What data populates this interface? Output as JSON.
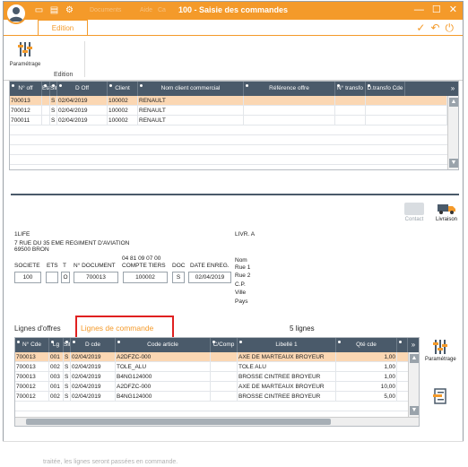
{
  "window": {
    "title": "100 - Saisie des commandes",
    "menu_ghost": [
      "Documents",
      "Aide",
      "Ca"
    ]
  },
  "ribbon": {
    "tab_label": "Edition",
    "param_label": "Paramétrage",
    "group_label": "Edition"
  },
  "offers_grid": {
    "headers": [
      "N° off",
      "Eta",
      "Sit",
      "D Off",
      "Client",
      "Nom client commercial",
      "Référence offre",
      "N° transfo",
      "D.transfo Cde"
    ],
    "rows": [
      {
        "n": "700013",
        "eta": "",
        "sit": "S",
        "date": "02/04/2019",
        "client": "100002",
        "name": "RENAULT",
        "ref": "",
        "transfo": "",
        "dtransfo": "",
        "selected": true
      },
      {
        "n": "700012",
        "eta": "",
        "sit": "S",
        "date": "02/04/2019",
        "client": "100002",
        "name": "RENAULT",
        "ref": "",
        "transfo": "",
        "dtransfo": "",
        "selected": false
      },
      {
        "n": "700011",
        "eta": "",
        "sit": "S",
        "date": "02/04/2019",
        "client": "100002",
        "name": "RENAULT",
        "ref": "",
        "transfo": "",
        "dtransfo": "",
        "selected": false
      }
    ]
  },
  "actions": {
    "contact": "Contact",
    "livraison": "Livraison"
  },
  "client": {
    "name": "1LIFE",
    "address1": "7 RUE DU 35 EME REGIMENT D'AVIATION",
    "address2": "69500 BRON",
    "phone": "04 81 09 07 00"
  },
  "doc_labels": {
    "societe": "SOCIETE",
    "ets": "ETS",
    "t": "T",
    "num_doc": "N° DOCUMENT",
    "compte": "COMPTE TIERS",
    "doc": "DOC",
    "date_enreg": "DATE ENREG."
  },
  "doc_values": {
    "societe": "100",
    "ets": "",
    "t": "O",
    "num_doc": "700013",
    "compte": "100002",
    "doc": "S",
    "date_enreg": "02/04/2019"
  },
  "delivery": {
    "title": "LIVR. A",
    "labels": [
      "Nom",
      "Rue 1",
      "Rue 2",
      "C.P.",
      "Ville",
      "Pays"
    ]
  },
  "tabs": {
    "offers": "Lignes d'offres",
    "orders": "Lignes de commande",
    "count": "5 lignes"
  },
  "order_lines": {
    "headers": [
      "N° Cde",
      "Lg",
      "Sit",
      "D cde",
      "Code article",
      "C/Comp",
      "Libellé 1",
      "Qté cde"
    ],
    "rows": [
      {
        "cde": "700013",
        "lg": "001",
        "sit": "S",
        "date": "02/04/2019",
        "code": "A2DFZC-000",
        "comp": "",
        "lib": "AXE DE MARTEAUX BROYEUR",
        "qte": "1,00",
        "selected": true
      },
      {
        "cde": "700013",
        "lg": "002",
        "sit": "S",
        "date": "02/04/2019",
        "code": "TOLE_ALU",
        "comp": "",
        "lib": "TOLE ALU",
        "qte": "1,00",
        "selected": false
      },
      {
        "cde": "700013",
        "lg": "003",
        "sit": "S",
        "date": "02/04/2019",
        "code": "B4NG124000",
        "comp": "",
        "lib": "BROSSE CINTREE BROYEUR",
        "qte": "1,00",
        "selected": false
      },
      {
        "cde": "700012",
        "lg": "001",
        "sit": "S",
        "date": "02/04/2019",
        "code": "A2DFZC-000",
        "comp": "",
        "lib": "AXE DE MARTEAUX BROYEUR",
        "qte": "10,00",
        "selected": false
      },
      {
        "cde": "700012",
        "lg": "002",
        "sit": "S",
        "date": "02/04/2019",
        "code": "B4NG124000",
        "comp": "",
        "lib": "BROSSE CINTREE BROYEUR",
        "qte": "5,00",
        "selected": false
      }
    ],
    "side_param_label": "Paramétrage"
  },
  "footer_ghost": "traitée, les lignes seront passées en commande.",
  "colors": {
    "accent": "#f49a2a",
    "header": "#4a5a6a",
    "selected": "#fbd7b3",
    "highlight": "#e02020"
  }
}
